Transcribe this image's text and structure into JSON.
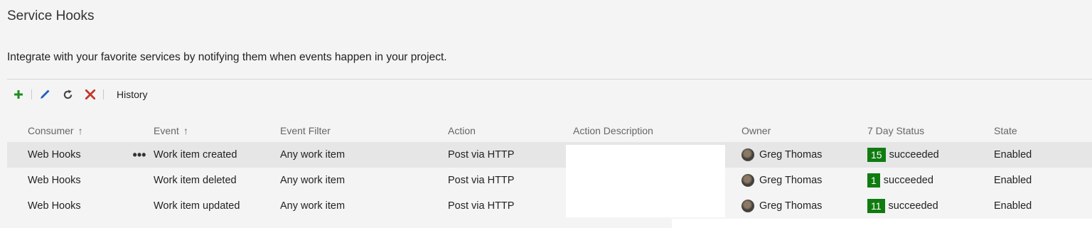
{
  "page": {
    "title": "Service Hooks",
    "intro": "Integrate with your favorite services by notifying them when events happen in your project."
  },
  "toolbar": {
    "add_icon": "plus-icon",
    "edit_icon": "pencil-icon",
    "refresh_icon": "refresh-icon",
    "delete_icon": "delete-x-icon",
    "history_label": "History"
  },
  "colors": {
    "add": "#1e8c1e",
    "edit": "#1e5fbf",
    "delete": "#c0392b",
    "badge": "#107c10",
    "selected_row": "#e6e6e6"
  },
  "grid": {
    "columns": {
      "consumer": "Consumer",
      "event": "Event",
      "event_filter": "Event Filter",
      "action": "Action",
      "action_description": "Action Description",
      "owner": "Owner",
      "status": "7 Day Status",
      "state": "State"
    },
    "sort_arrow": "↑",
    "more_glyph": "•••",
    "rows": [
      {
        "consumer": "Web Hooks",
        "event": "Work item created",
        "filter": "Any work item",
        "action": "Post via HTTP",
        "description": "",
        "owner": "Greg Thomas",
        "status_count": "15",
        "status_text": "succeeded",
        "state": "Enabled"
      },
      {
        "consumer": "Web Hooks",
        "event": "Work item deleted",
        "filter": "Any work item",
        "action": "Post via HTTP",
        "description": "",
        "owner": "Greg Thomas",
        "status_count": "1",
        "status_text": "succeeded",
        "state": "Enabled"
      },
      {
        "consumer": "Web Hooks",
        "event": "Work item updated",
        "filter": "Any work item",
        "action": "Post via HTTP",
        "description": "",
        "owner": "Greg Thomas",
        "status_count": "11",
        "status_text": "succeeded",
        "state": "Enabled"
      }
    ]
  }
}
